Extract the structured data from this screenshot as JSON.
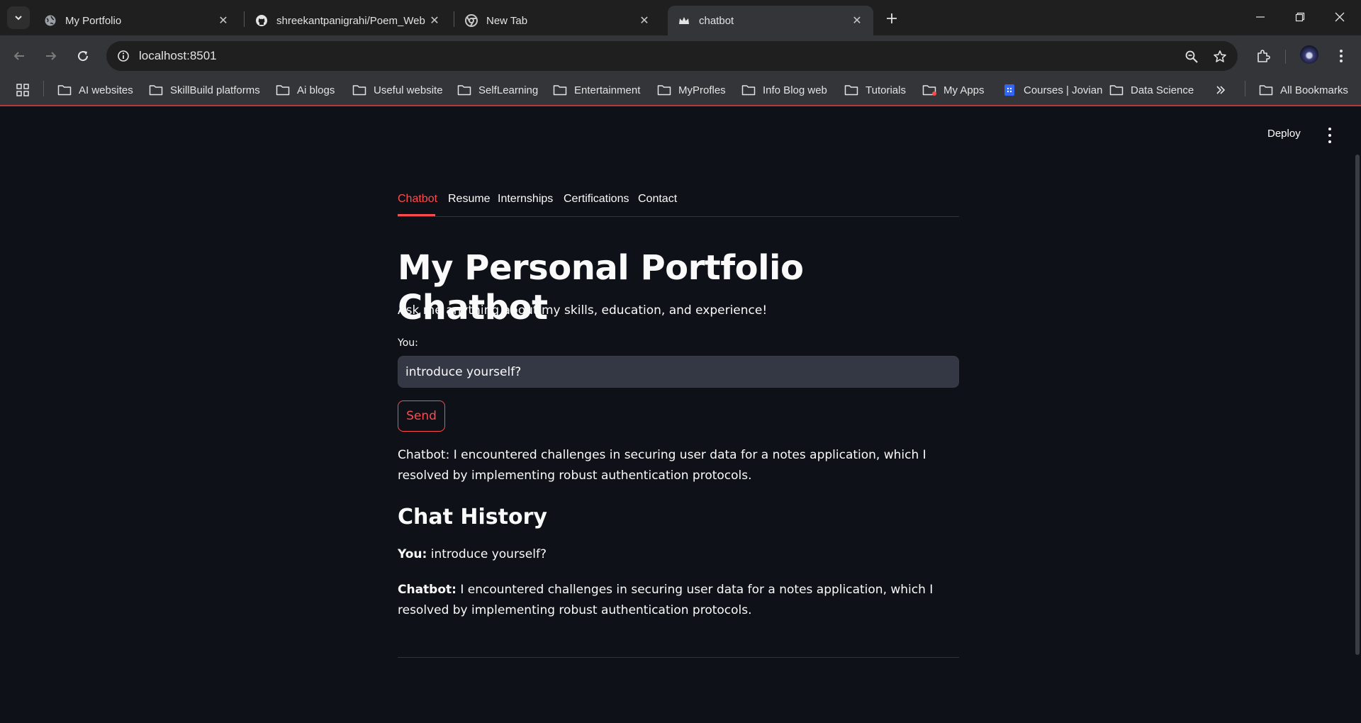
{
  "browser": {
    "tabs": [
      {
        "title": "My Portfolio",
        "icon": "globe-icon",
        "active": false
      },
      {
        "title": "shreekantpanigrahi/Poem_Web",
        "icon": "github-icon",
        "active": false
      },
      {
        "title": "New Tab",
        "icon": "chrome-icon",
        "active": false
      },
      {
        "title": "chatbot",
        "icon": "streamlit-crown-icon",
        "active": true
      }
    ],
    "url": "localhost:8501",
    "bookmarks": [
      {
        "label": "AI websites",
        "icon": "folder-icon"
      },
      {
        "label": "SkillBuild platforms",
        "icon": "folder-icon"
      },
      {
        "label": "Ai blogs",
        "icon": "folder-icon"
      },
      {
        "label": "Useful website",
        "icon": "folder-icon"
      },
      {
        "label": "SelfLearning",
        "icon": "folder-icon"
      },
      {
        "label": "Entertainment",
        "icon": "folder-icon"
      },
      {
        "label": "MyProfles",
        "icon": "folder-icon"
      },
      {
        "label": "Info Blog web",
        "icon": "folder-icon"
      },
      {
        "label": "Tutorials",
        "icon": "folder-icon"
      },
      {
        "label": "My Apps",
        "icon": "folder-icon"
      },
      {
        "label": "Courses | Jovian",
        "icon": "jovian-icon"
      },
      {
        "label": "Data Science",
        "icon": "folder-icon"
      }
    ],
    "all_bookmarks": "All Bookmarks"
  },
  "app": {
    "deploy_label": "Deploy",
    "tabs": [
      {
        "label": "Chatbot",
        "active": true
      },
      {
        "label": "Resume",
        "active": false
      },
      {
        "label": "Internships",
        "active": false
      },
      {
        "label": "Certifications",
        "active": false
      },
      {
        "label": "Contact",
        "active": false
      }
    ],
    "title": "My Personal Portfolio Chatbot",
    "subtitle": "Ask me anything about my skills, education, and experience!",
    "input_label": "You:",
    "input_value": "introduce yourself?",
    "send_label": "Send",
    "reply": "Chatbot: I encountered challenges in securing user data for a notes application, which I resolved by implementing robust authentication protocols.",
    "history_heading": "Chat History",
    "history": {
      "user_prefix": "You:",
      "user_text": "introduce yourself?",
      "bot_prefix": "Chatbot:",
      "bot_text": "I encountered challenges in securing user data for a notes application, which I resolved by implementing robust authentication protocols."
    }
  },
  "colors": {
    "accent": "#ff4b4b",
    "background": "#0e1117",
    "input_bg": "#343844"
  }
}
